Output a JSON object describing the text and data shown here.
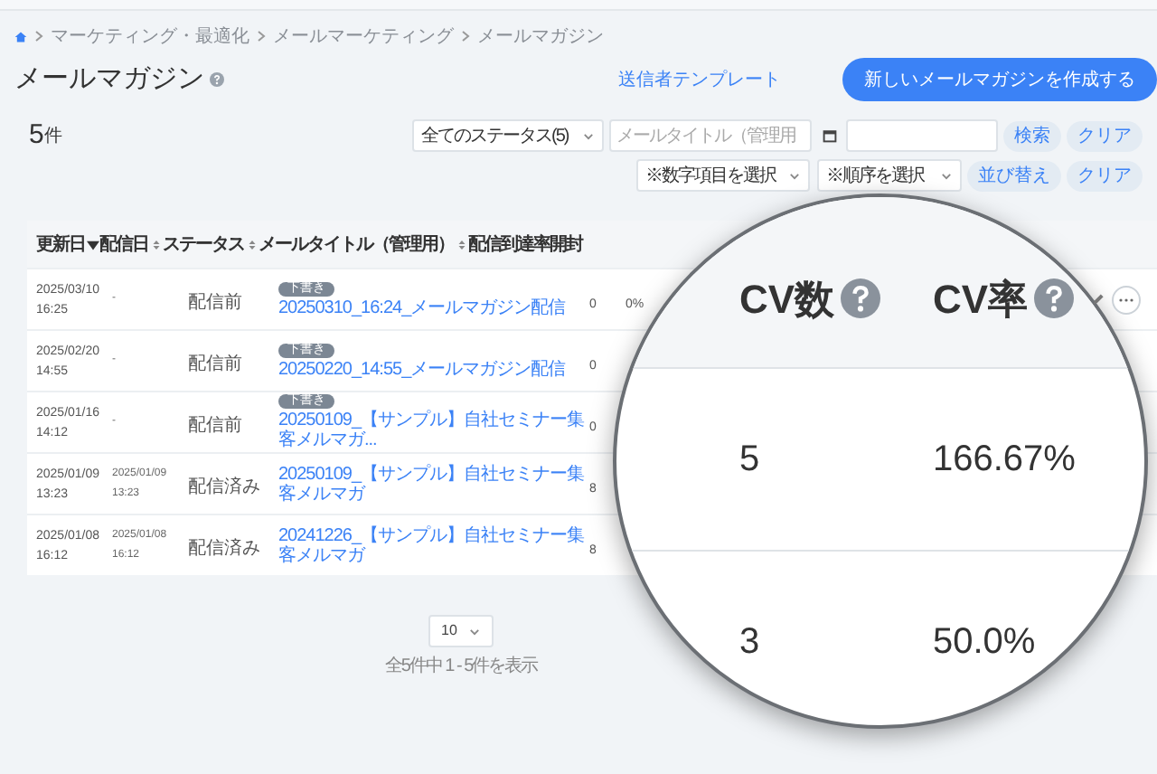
{
  "breadcrumb": [
    "マーケティング・最適化",
    "メールマーケティング",
    "メールマガジン"
  ],
  "title": "メールマガジン",
  "header_buttons": [
    {
      "kind": "link",
      "label": "送信者テンプレート"
    },
    {
      "kind": "primary",
      "label": "新しいメールマガジンを作成する"
    }
  ],
  "count": {
    "number": "5",
    "unit": "件"
  },
  "filters": {
    "status": "全てのステータス(5)",
    "title_placeholder": "メールタイトル（管理用",
    "buttons": [
      "検索",
      "クリア"
    ]
  },
  "sort": {
    "field": "※数字項目を選択",
    "order": "※順序を選択",
    "buttons": [
      "並び替え",
      "クリア"
    ]
  },
  "table": {
    "columns": [
      {
        "label": "更新日",
        "sortable": true,
        "sorted": true
      },
      {
        "label": "配信日",
        "sortable": true,
        "sorted": false
      },
      {
        "label": "ステータス",
        "sortable": true,
        "sorted": false
      },
      {
        "label": "メールタイトル（管理用）",
        "sortable": true,
        "sorted": false
      },
      {
        "label": "配信",
        "sortable": false
      },
      {
        "label": "到達率",
        "sortable": false
      },
      {
        "label": "開封",
        "sortable": false
      }
    ],
    "rows": [
      {
        "updated": [
          "2025/03/10",
          "16:25"
        ],
        "sent": [
          "-"
        ],
        "status": "配信前",
        "tag": "下書き",
        "title": "20250310_16:24_メールマガジン配信",
        "delivered": "0",
        "reach": "0%",
        "actions": true
      },
      {
        "updated": [
          "2025/02/20",
          "14:55"
        ],
        "sent": [
          "-"
        ],
        "status": "配信前",
        "tag": "下書き",
        "title": "20250220_14:55_メールマガジン配信",
        "delivered": "0"
      },
      {
        "updated": [
          "2025/01/16",
          "14:12"
        ],
        "sent": [
          "-"
        ],
        "status": "配信前",
        "tag": "下書き",
        "title": "20250109_【サンプル】自社セミナー集客メルマガ...",
        "delivered": "0"
      },
      {
        "updated": [
          "2025/01/09",
          "13:23"
        ],
        "sent": [
          "2025/01/09",
          "13:23"
        ],
        "status": "配信済み",
        "title": "20250109_【サンプル】自社セミナー集客メルマガ",
        "delivered": "8"
      },
      {
        "updated": [
          "2025/01/08",
          "16:12"
        ],
        "sent": [
          "2025/01/08",
          "16:12"
        ],
        "status": "配信済み",
        "title": "20241226_【サンプル】自社セミナー集客メルマガ",
        "delivered": "8"
      }
    ]
  },
  "pagination": {
    "per_page": "10",
    "summary": "全5件中 1 - 5件を表示"
  },
  "magnifier": {
    "columns": [
      "CV数",
      "CV率"
    ],
    "rows": [
      [
        "5",
        "166.67%"
      ],
      [
        "3",
        "50.0%"
      ]
    ]
  }
}
